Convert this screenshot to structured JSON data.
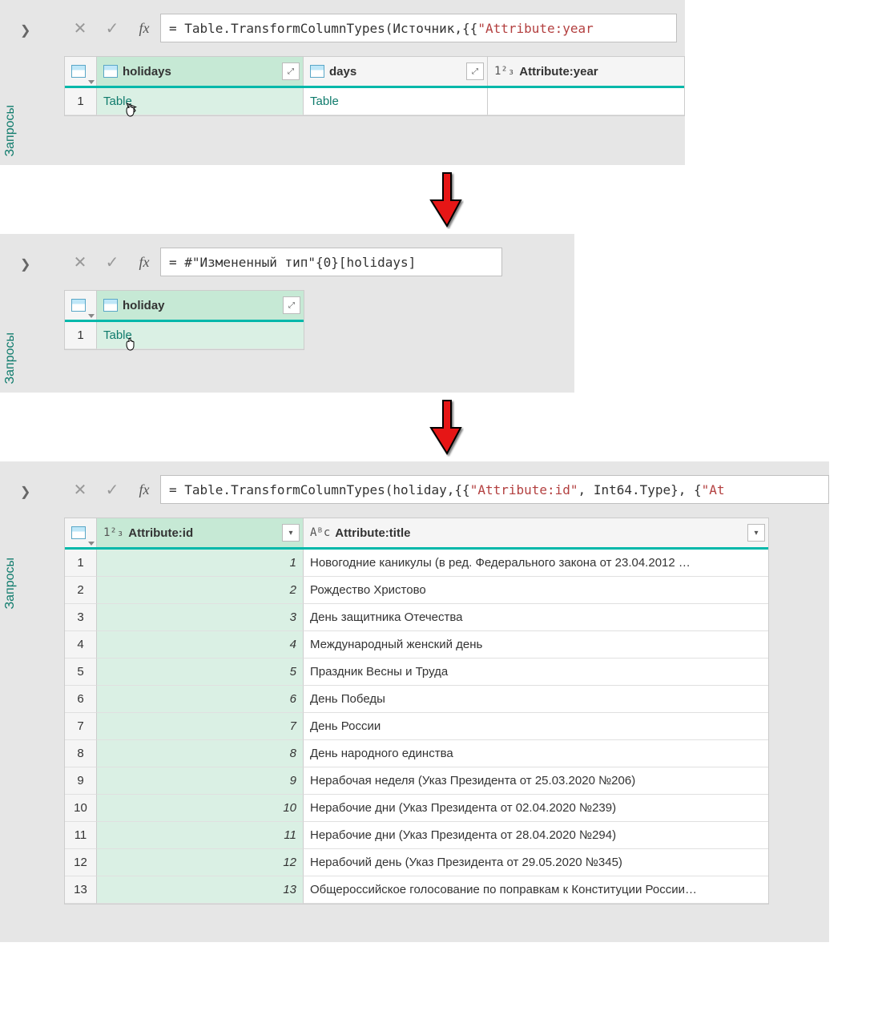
{
  "sidebar_label": "Запросы",
  "panel1": {
    "formula_prefix": "= Table.TransformColumnTypes(Источник,{{",
    "formula_str": "\"Attribute:year",
    "cols": [
      "holidays",
      "days",
      "Attribute:year"
    ],
    "row1": [
      "Table",
      "Table",
      ""
    ]
  },
  "panel2": {
    "formula_prefix": "= #\"Измененный тип\"{0}[holidays]",
    "cols": [
      "holiday"
    ],
    "row1": [
      "Table"
    ]
  },
  "panel3": {
    "formula_prefix": "= Table.TransformColumnTypes(holiday,{{",
    "formula_str1": "\"Attribute:id\"",
    "formula_mid": ", Int64.Type}, {",
    "formula_str2": "\"At",
    "cols": [
      "Attribute:id",
      "Attribute:title"
    ],
    "rows": [
      {
        "id": "1",
        "title": "Новогодние каникулы (в ред. Федерального закона от 23.04.2012 …"
      },
      {
        "id": "2",
        "title": "Рождество Христово"
      },
      {
        "id": "3",
        "title": "День защитника Отечества"
      },
      {
        "id": "4",
        "title": "Международный женский день"
      },
      {
        "id": "5",
        "title": "Праздник Весны и Труда"
      },
      {
        "id": "6",
        "title": "День Победы"
      },
      {
        "id": "7",
        "title": "День России"
      },
      {
        "id": "8",
        "title": "День народного единства"
      },
      {
        "id": "9",
        "title": "Нерабочая неделя (Указ Президента от 25.03.2020 №206)"
      },
      {
        "id": "10",
        "title": "Нерабочие дни (Указ Президента от 02.04.2020 №239)"
      },
      {
        "id": "11",
        "title": "Нерабочие дни (Указ Президента от 28.04.2020 №294)"
      },
      {
        "id": "12",
        "title": "Нерабочий день (Указ Президента от 29.05.2020 №345)"
      },
      {
        "id": "13",
        "title": "Общероссийское голосование по поправкам к Конституции России…"
      }
    ]
  }
}
